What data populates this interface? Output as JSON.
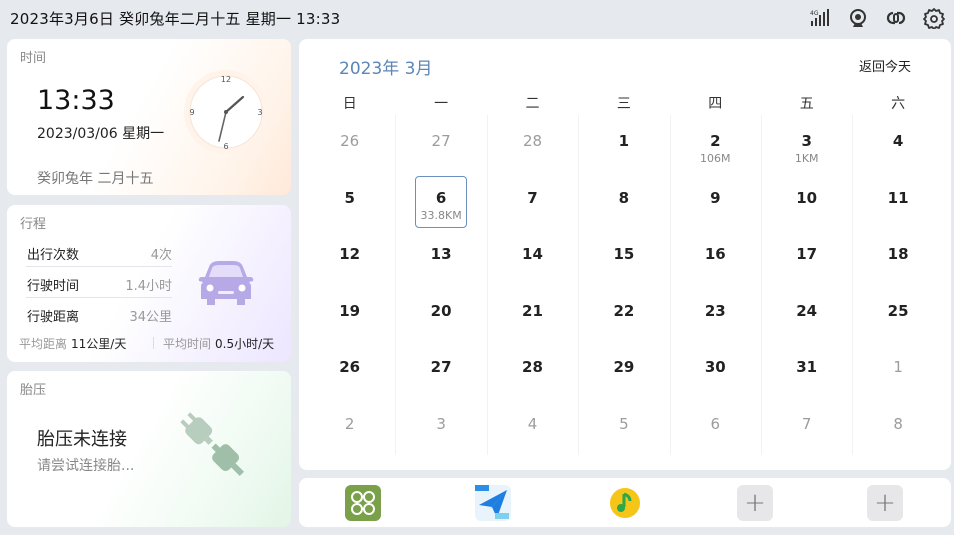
{
  "status_bar": {
    "text": "2023年3月6日  癸卯兔年二月十五  星期一  13:33",
    "icons": [
      "signal-4g-icon",
      "camera-icon",
      "link-icon",
      "settings-icon"
    ]
  },
  "time_card": {
    "title": "时间",
    "time": "13:33",
    "date": "2023/03/06 星期一",
    "lunar": "癸卯兔年 二月十五",
    "clock_labels": [
      "12",
      "3",
      "6",
      "9"
    ]
  },
  "trip_card": {
    "title": "行程",
    "rows": [
      {
        "label": "出行次数",
        "value": "4次"
      },
      {
        "label": "行驶时间",
        "value": "1.4小时"
      },
      {
        "label": "行驶距离",
        "value": "34公里"
      }
    ],
    "avg_distance_label": "平均距离",
    "avg_distance_value": "11公里/天",
    "avg_time_label": "平均时间",
    "avg_time_value": "0.5小时/天"
  },
  "tire_card": {
    "title": "胎压",
    "status": "胎压未连接",
    "hint": "请尝试连接胎..."
  },
  "calendar": {
    "month_label": "2023年 3月",
    "today_button": "返回今天",
    "weekdays": [
      "日",
      "一",
      "二",
      "三",
      "四",
      "五",
      "六"
    ],
    "weeks": [
      [
        {
          "d": "26",
          "m": true
        },
        {
          "d": "27",
          "m": true
        },
        {
          "d": "28",
          "m": true
        },
        {
          "d": "1"
        },
        {
          "d": "2",
          "sub": "106M"
        },
        {
          "d": "3",
          "sub": "1KM"
        },
        {
          "d": "4"
        }
      ],
      [
        {
          "d": "5"
        },
        {
          "d": "6",
          "sub": "33.8KM",
          "today": true
        },
        {
          "d": "7"
        },
        {
          "d": "8"
        },
        {
          "d": "9"
        },
        {
          "d": "10"
        },
        {
          "d": "11"
        }
      ],
      [
        {
          "d": "12"
        },
        {
          "d": "13"
        },
        {
          "d": "14"
        },
        {
          "d": "15"
        },
        {
          "d": "16"
        },
        {
          "d": "17"
        },
        {
          "d": "18"
        }
      ],
      [
        {
          "d": "19"
        },
        {
          "d": "20"
        },
        {
          "d": "21"
        },
        {
          "d": "22"
        },
        {
          "d": "23"
        },
        {
          "d": "24"
        },
        {
          "d": "25"
        }
      ],
      [
        {
          "d": "26"
        },
        {
          "d": "27"
        },
        {
          "d": "28"
        },
        {
          "d": "29"
        },
        {
          "d": "30"
        },
        {
          "d": "31"
        },
        {
          "d": "1",
          "m": true
        }
      ],
      [
        {
          "d": "2",
          "m": true
        },
        {
          "d": "3",
          "m": true
        },
        {
          "d": "4",
          "m": true
        },
        {
          "d": "5",
          "m": true
        },
        {
          "d": "6",
          "m": true
        },
        {
          "d": "7",
          "m": true
        },
        {
          "d": "8",
          "m": true
        }
      ]
    ]
  },
  "dock": {
    "apps": [
      {
        "name": "app-grid",
        "icon": "four-circles-icon",
        "color": "#7aa04a"
      },
      {
        "name": "navigation",
        "icon": "paper-plane-icon",
        "color": "#2b8fe8"
      },
      {
        "name": "music",
        "icon": "music-note-icon",
        "color": "#f5c518"
      },
      {
        "name": "add",
        "icon": "plus-icon",
        "label": "+"
      },
      {
        "name": "add",
        "icon": "plus-icon",
        "label": "+"
      }
    ]
  }
}
